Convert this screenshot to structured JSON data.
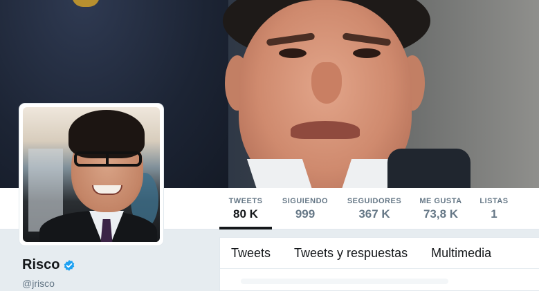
{
  "profile": {
    "name": "Risco",
    "handle": "@jrisco",
    "verified": true
  },
  "stats": [
    {
      "label": "TWEETS",
      "value": "80 K",
      "active": true
    },
    {
      "label": "SIGUIENDO",
      "value": "999",
      "active": false
    },
    {
      "label": "SEGUIDORES",
      "value": "367 K",
      "active": false
    },
    {
      "label": "ME GUSTA",
      "value": "73,8 K",
      "active": false
    },
    {
      "label": "LISTAS",
      "value": "1",
      "active": false
    }
  ],
  "tabs": [
    {
      "label": "Tweets"
    },
    {
      "label": "Tweets y respuestas"
    },
    {
      "label": "Multimedia"
    }
  ],
  "colors": {
    "verified": "#1da1f2",
    "text_primary": "#14171a",
    "text_secondary": "#657786",
    "background": "#e6ecf0"
  },
  "icons": {
    "verified": "verified-badge-icon"
  }
}
